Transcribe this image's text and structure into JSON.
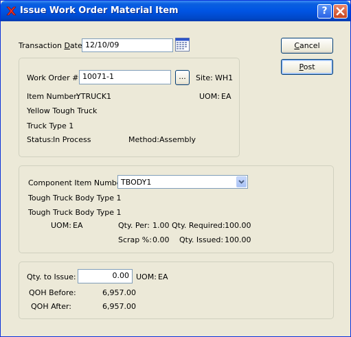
{
  "window": {
    "title": "Issue Work Order Material Item"
  },
  "transaction": {
    "date_label_pre": "Transaction ",
    "date_label_ul": "D",
    "date_label_post": "ate:",
    "date_value": "12/10/09"
  },
  "buttons": {
    "cancel_ul": "C",
    "cancel_rest": "ancel",
    "post_ul": "P",
    "post_rest": "ost",
    "ellipsis": "..."
  },
  "work_order": {
    "label": "Work Order #:",
    "value": "10071-1",
    "site_label": "Site:",
    "site_value": "WH1",
    "item_number_label": "Item Number:",
    "item_number_value": "YTRUCK1",
    "uom_label": "UOM:",
    "uom_value": "EA",
    "description1": "Yellow Tough Truck",
    "description2": "Truck Type 1",
    "status_label": "Status:",
    "status_value": "In Process",
    "method_label": "Method:",
    "method_value": "Assembly"
  },
  "component": {
    "label": "Component Item Number:",
    "value": "TBODY1",
    "description1": "Tough Truck Body Type 1",
    "description2": "Tough Truck Body Type 1",
    "uom_label": "UOM:",
    "uom_value": "EA",
    "qty_per_label": "Qty. Per:",
    "qty_per_value": "1.00",
    "qty_required_label": "Qty. Required:",
    "qty_required_value": "100.00",
    "scrap_label": "Scrap %:",
    "scrap_value": "0.00",
    "qty_issued_label": "Qty. Issued:",
    "qty_issued_value": "100.00"
  },
  "issue": {
    "qty_label": "Qty. to Issue:",
    "qty_value": "0.00",
    "uom_label": "UOM:",
    "uom_value": "EA",
    "qoh_before_label": "QOH Before:",
    "qoh_before_value": "6,957.00",
    "qoh_after_label": "QOH After:",
    "qoh_after_value": "6,957.00"
  }
}
